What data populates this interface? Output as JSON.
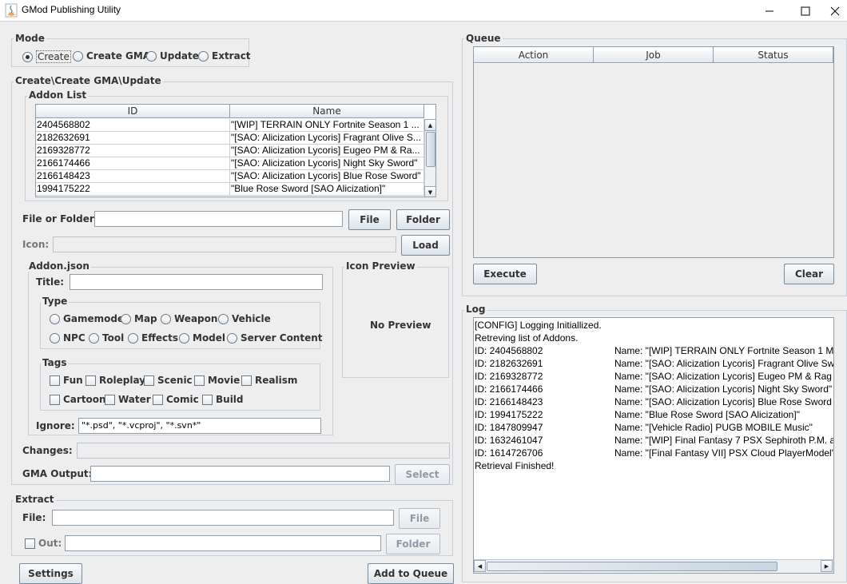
{
  "window": {
    "title": "GMod Publishing Utility"
  },
  "mode": {
    "title": "Mode",
    "options": [
      "Create",
      "Create GMA",
      "Update",
      "Extract"
    ],
    "selected": "Create"
  },
  "create_group": {
    "title": "Create\\Create GMA\\Update",
    "addon_list": {
      "title": "Addon List",
      "columns": [
        "ID",
        "Name"
      ],
      "rows": [
        {
          "id": "2404568802",
          "name": "\"[WIP] TERRAIN ONLY Fortnite Season 1 ..."
        },
        {
          "id": "2182632691",
          "name": "\"[SAO: Alicization Lycoris] Fragrant Olive S..."
        },
        {
          "id": "2169328772",
          "name": "\"[SAO: Alicization Lycoris] Eugeo PM & Ra..."
        },
        {
          "id": "2166174466",
          "name": "\"[SAO: Alicization Lycoris] Night Sky Sword\""
        },
        {
          "id": "2166148423",
          "name": "\"[SAO: Alicization Lycoris] Blue Rose Sword\""
        },
        {
          "id": "1994175222",
          "name": "\"Blue Rose Sword [SAO Alicization]\""
        }
      ]
    },
    "file_or_folder_label": "File or Folder:",
    "file_or_folder_value": "",
    "file_button": "File",
    "folder_button": "Folder",
    "icon_label": "Icon:",
    "icon_value": "",
    "load_button": "Load",
    "addon_json": {
      "title": "Addon.json",
      "title_label": "Title:",
      "title_value": "",
      "type_title": "Type",
      "types": [
        "Gamemode",
        "Map",
        "Weapon",
        "Vehicle",
        "NPC",
        "Tool",
        "Effects",
        "Model",
        "Server Content"
      ],
      "tags_title": "Tags",
      "tags": [
        "Fun",
        "Roleplay",
        "Scenic",
        "Movie",
        "Realism",
        "Cartoon",
        "Water",
        "Comic",
        "Build"
      ],
      "ignore_label": "Ignore:",
      "ignore_value": "\"*.psd\", \"*.vcproj\", \"*.svn*\""
    },
    "icon_preview": {
      "title": "Icon Preview",
      "text": "No Preview"
    },
    "changes_label": "Changes:",
    "changes_value": "",
    "gma_output_label": "GMA Output:",
    "gma_output_value": "",
    "select_button": "Select"
  },
  "extract": {
    "title": "Extract",
    "file_label": "File:",
    "file_value": "",
    "file_button": "File",
    "out_label": "Out:",
    "out_value": "",
    "folder_button": "Folder"
  },
  "settings_button": "Settings",
  "add_to_queue_button": "Add to Queue",
  "queue": {
    "title": "Queue",
    "columns": [
      "Action",
      "Job",
      "Status"
    ],
    "execute_button": "Execute",
    "clear_button": "Clear"
  },
  "log": {
    "title": "Log",
    "lines": [
      "[CONFIG] Logging Initiallized.",
      "Retreving list of Addons."
    ],
    "entries": [
      {
        "id": "ID: 2404568802",
        "name": "Name: \"[WIP] TERRAIN ONLY Fortnite Season 1 M"
      },
      {
        "id": "ID: 2182632691",
        "name": "Name: \"[SAO: Alicization Lycoris] Fragrant Olive Sw"
      },
      {
        "id": "ID: 2169328772",
        "name": "Name: \"[SAO: Alicization Lycoris] Eugeo PM & Rag"
      },
      {
        "id": "ID: 2166174466",
        "name": "Name: \"[SAO: Alicization Lycoris] Night Sky Sword\""
      },
      {
        "id": "ID: 2166148423",
        "name": "Name: \"[SAO: Alicization Lycoris] Blue Rose Sword"
      },
      {
        "id": "ID: 1994175222",
        "name": "Name: \"Blue Rose Sword [SAO Alicization]\""
      },
      {
        "id": "ID: 1847809947",
        "name": "Name: \"[Vehicle Radio] PUGB MOBILE Music\""
      },
      {
        "id": "ID: 1632461047",
        "name": "Name: \"[WIP] Final Fantasy 7 PSX Sephiroth P.M. a"
      },
      {
        "id": "ID: 1614726706",
        "name": "Name: \"[Final Fantasy VII] PSX Cloud PlayerModel\""
      }
    ],
    "footer": "Retrieval Finished!"
  }
}
